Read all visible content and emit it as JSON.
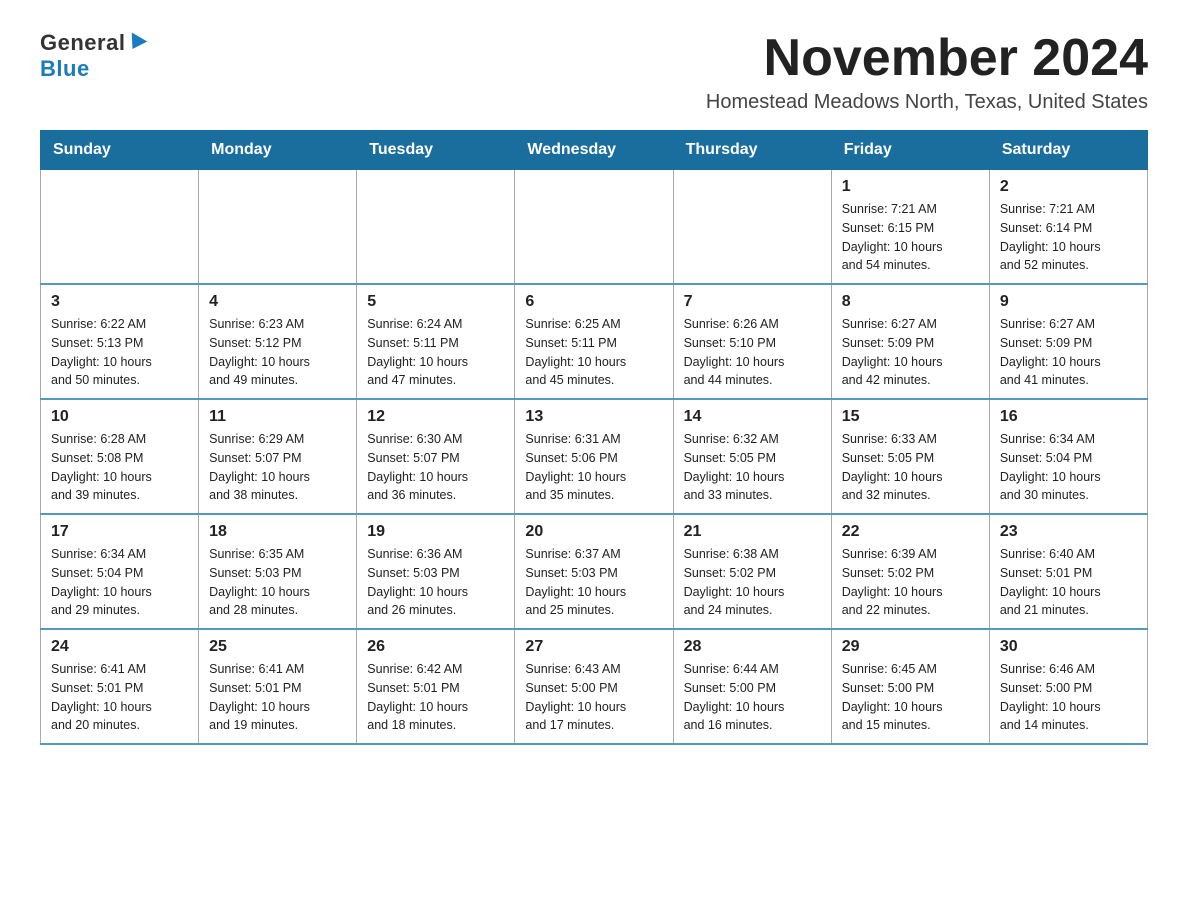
{
  "logo": {
    "general": "General",
    "blue": "Blue"
  },
  "title": "November 2024",
  "location": "Homestead Meadows North, Texas, United States",
  "weekdays": [
    "Sunday",
    "Monday",
    "Tuesday",
    "Wednesday",
    "Thursday",
    "Friday",
    "Saturday"
  ],
  "weeks": [
    [
      {
        "day": "",
        "info": ""
      },
      {
        "day": "",
        "info": ""
      },
      {
        "day": "",
        "info": ""
      },
      {
        "day": "",
        "info": ""
      },
      {
        "day": "",
        "info": ""
      },
      {
        "day": "1",
        "info": "Sunrise: 7:21 AM\nSunset: 6:15 PM\nDaylight: 10 hours\nand 54 minutes."
      },
      {
        "day": "2",
        "info": "Sunrise: 7:21 AM\nSunset: 6:14 PM\nDaylight: 10 hours\nand 52 minutes."
      }
    ],
    [
      {
        "day": "3",
        "info": "Sunrise: 6:22 AM\nSunset: 5:13 PM\nDaylight: 10 hours\nand 50 minutes."
      },
      {
        "day": "4",
        "info": "Sunrise: 6:23 AM\nSunset: 5:12 PM\nDaylight: 10 hours\nand 49 minutes."
      },
      {
        "day": "5",
        "info": "Sunrise: 6:24 AM\nSunset: 5:11 PM\nDaylight: 10 hours\nand 47 minutes."
      },
      {
        "day": "6",
        "info": "Sunrise: 6:25 AM\nSunset: 5:11 PM\nDaylight: 10 hours\nand 45 minutes."
      },
      {
        "day": "7",
        "info": "Sunrise: 6:26 AM\nSunset: 5:10 PM\nDaylight: 10 hours\nand 44 minutes."
      },
      {
        "day": "8",
        "info": "Sunrise: 6:27 AM\nSunset: 5:09 PM\nDaylight: 10 hours\nand 42 minutes."
      },
      {
        "day": "9",
        "info": "Sunrise: 6:27 AM\nSunset: 5:09 PM\nDaylight: 10 hours\nand 41 minutes."
      }
    ],
    [
      {
        "day": "10",
        "info": "Sunrise: 6:28 AM\nSunset: 5:08 PM\nDaylight: 10 hours\nand 39 minutes."
      },
      {
        "day": "11",
        "info": "Sunrise: 6:29 AM\nSunset: 5:07 PM\nDaylight: 10 hours\nand 38 minutes."
      },
      {
        "day": "12",
        "info": "Sunrise: 6:30 AM\nSunset: 5:07 PM\nDaylight: 10 hours\nand 36 minutes."
      },
      {
        "day": "13",
        "info": "Sunrise: 6:31 AM\nSunset: 5:06 PM\nDaylight: 10 hours\nand 35 minutes."
      },
      {
        "day": "14",
        "info": "Sunrise: 6:32 AM\nSunset: 5:05 PM\nDaylight: 10 hours\nand 33 minutes."
      },
      {
        "day": "15",
        "info": "Sunrise: 6:33 AM\nSunset: 5:05 PM\nDaylight: 10 hours\nand 32 minutes."
      },
      {
        "day": "16",
        "info": "Sunrise: 6:34 AM\nSunset: 5:04 PM\nDaylight: 10 hours\nand 30 minutes."
      }
    ],
    [
      {
        "day": "17",
        "info": "Sunrise: 6:34 AM\nSunset: 5:04 PM\nDaylight: 10 hours\nand 29 minutes."
      },
      {
        "day": "18",
        "info": "Sunrise: 6:35 AM\nSunset: 5:03 PM\nDaylight: 10 hours\nand 28 minutes."
      },
      {
        "day": "19",
        "info": "Sunrise: 6:36 AM\nSunset: 5:03 PM\nDaylight: 10 hours\nand 26 minutes."
      },
      {
        "day": "20",
        "info": "Sunrise: 6:37 AM\nSunset: 5:03 PM\nDaylight: 10 hours\nand 25 minutes."
      },
      {
        "day": "21",
        "info": "Sunrise: 6:38 AM\nSunset: 5:02 PM\nDaylight: 10 hours\nand 24 minutes."
      },
      {
        "day": "22",
        "info": "Sunrise: 6:39 AM\nSunset: 5:02 PM\nDaylight: 10 hours\nand 22 minutes."
      },
      {
        "day": "23",
        "info": "Sunrise: 6:40 AM\nSunset: 5:01 PM\nDaylight: 10 hours\nand 21 minutes."
      }
    ],
    [
      {
        "day": "24",
        "info": "Sunrise: 6:41 AM\nSunset: 5:01 PM\nDaylight: 10 hours\nand 20 minutes."
      },
      {
        "day": "25",
        "info": "Sunrise: 6:41 AM\nSunset: 5:01 PM\nDaylight: 10 hours\nand 19 minutes."
      },
      {
        "day": "26",
        "info": "Sunrise: 6:42 AM\nSunset: 5:01 PM\nDaylight: 10 hours\nand 18 minutes."
      },
      {
        "day": "27",
        "info": "Sunrise: 6:43 AM\nSunset: 5:00 PM\nDaylight: 10 hours\nand 17 minutes."
      },
      {
        "day": "28",
        "info": "Sunrise: 6:44 AM\nSunset: 5:00 PM\nDaylight: 10 hours\nand 16 minutes."
      },
      {
        "day": "29",
        "info": "Sunrise: 6:45 AM\nSunset: 5:00 PM\nDaylight: 10 hours\nand 15 minutes."
      },
      {
        "day": "30",
        "info": "Sunrise: 6:46 AM\nSunset: 5:00 PM\nDaylight: 10 hours\nand 14 minutes."
      }
    ]
  ]
}
